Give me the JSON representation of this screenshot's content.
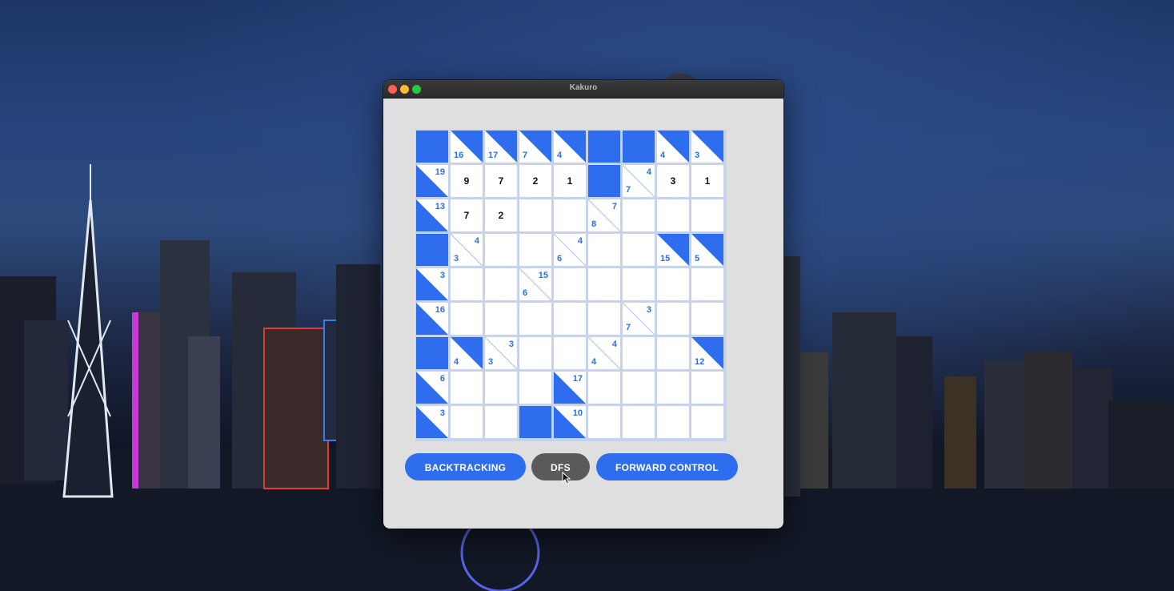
{
  "window": {
    "title": "Kakuro"
  },
  "board": {
    "rows": [
      [
        {
          "t": "block"
        },
        {
          "t": "clue",
          "d": "16"
        },
        {
          "t": "clue",
          "d": "17"
        },
        {
          "t": "clue",
          "d": "7"
        },
        {
          "t": "clue",
          "d": "4"
        },
        {
          "t": "block"
        },
        {
          "t": "block"
        },
        {
          "t": "clue",
          "d": "4"
        },
        {
          "t": "clue",
          "d": "3"
        }
      ],
      [
        {
          "t": "clue",
          "r": "19"
        },
        {
          "t": "val",
          "v": "9"
        },
        {
          "t": "val",
          "v": "7"
        },
        {
          "t": "val",
          "v": "2"
        },
        {
          "t": "val",
          "v": "1"
        },
        {
          "t": "block"
        },
        {
          "t": "clue",
          "r": "4",
          "d": "7",
          "light": true
        },
        {
          "t": "val",
          "v": "3"
        },
        {
          "t": "val",
          "v": "1"
        }
      ],
      [
        {
          "t": "clue",
          "r": "13"
        },
        {
          "t": "val",
          "v": "7"
        },
        {
          "t": "val",
          "v": "2"
        },
        {
          "t": "val",
          "v": ""
        },
        {
          "t": "val",
          "v": ""
        },
        {
          "t": "clue",
          "r": "7",
          "d": "8",
          "light": true
        },
        {
          "t": "val",
          "v": ""
        },
        {
          "t": "val",
          "v": ""
        },
        {
          "t": "val",
          "v": ""
        }
      ],
      [
        {
          "t": "block"
        },
        {
          "t": "clue",
          "r": "4",
          "d": "3",
          "light": true
        },
        {
          "t": "val",
          "v": ""
        },
        {
          "t": "val",
          "v": ""
        },
        {
          "t": "clue",
          "r": "4",
          "d": "6",
          "light": true
        },
        {
          "t": "val",
          "v": ""
        },
        {
          "t": "val",
          "v": ""
        },
        {
          "t": "clue",
          "d": "15"
        },
        {
          "t": "clue",
          "d": "5"
        }
      ],
      [
        {
          "t": "clue",
          "r": "3"
        },
        {
          "t": "val",
          "v": ""
        },
        {
          "t": "val",
          "v": ""
        },
        {
          "t": "clue",
          "r": "15",
          "d": "6",
          "light": true
        },
        {
          "t": "val",
          "v": ""
        },
        {
          "t": "val",
          "v": ""
        },
        {
          "t": "val",
          "v": ""
        },
        {
          "t": "val",
          "v": ""
        },
        {
          "t": "val",
          "v": ""
        }
      ],
      [
        {
          "t": "clue",
          "r": "16"
        },
        {
          "t": "val",
          "v": ""
        },
        {
          "t": "val",
          "v": ""
        },
        {
          "t": "val",
          "v": ""
        },
        {
          "t": "val",
          "v": ""
        },
        {
          "t": "val",
          "v": ""
        },
        {
          "t": "clue",
          "r": "3",
          "d": "7",
          "light": true
        },
        {
          "t": "val",
          "v": ""
        },
        {
          "t": "val",
          "v": ""
        }
      ],
      [
        {
          "t": "block"
        },
        {
          "t": "clue",
          "d": "4"
        },
        {
          "t": "clue",
          "r": "3",
          "d": "3",
          "light": true
        },
        {
          "t": "val",
          "v": ""
        },
        {
          "t": "val",
          "v": ""
        },
        {
          "t": "clue",
          "r": "4",
          "d": "4",
          "light": true
        },
        {
          "t": "val",
          "v": ""
        },
        {
          "t": "val",
          "v": ""
        },
        {
          "t": "clue",
          "d": "12"
        }
      ],
      [
        {
          "t": "clue",
          "r": "6"
        },
        {
          "t": "val",
          "v": ""
        },
        {
          "t": "val",
          "v": ""
        },
        {
          "t": "val",
          "v": ""
        },
        {
          "t": "clue",
          "r": "17"
        },
        {
          "t": "val",
          "v": ""
        },
        {
          "t": "val",
          "v": ""
        },
        {
          "t": "val",
          "v": ""
        },
        {
          "t": "val",
          "v": ""
        }
      ],
      [
        {
          "t": "clue",
          "r": "3"
        },
        {
          "t": "val",
          "v": ""
        },
        {
          "t": "val",
          "v": ""
        },
        {
          "t": "block"
        },
        {
          "t": "clue",
          "r": "10"
        },
        {
          "t": "val",
          "v": ""
        },
        {
          "t": "val",
          "v": ""
        },
        {
          "t": "val",
          "v": ""
        },
        {
          "t": "val",
          "v": ""
        }
      ]
    ]
  },
  "buttons": {
    "backtracking": "BACKTRACKING",
    "dfs": "DFS",
    "forward_control": "FORWARD CONTROL"
  },
  "colors": {
    "accent": "#2f6def",
    "clue_text": "#2d6ee6",
    "dfs_button": "#5a5a5a"
  },
  "icons": {
    "cursor": "arrow-cursor-icon"
  }
}
